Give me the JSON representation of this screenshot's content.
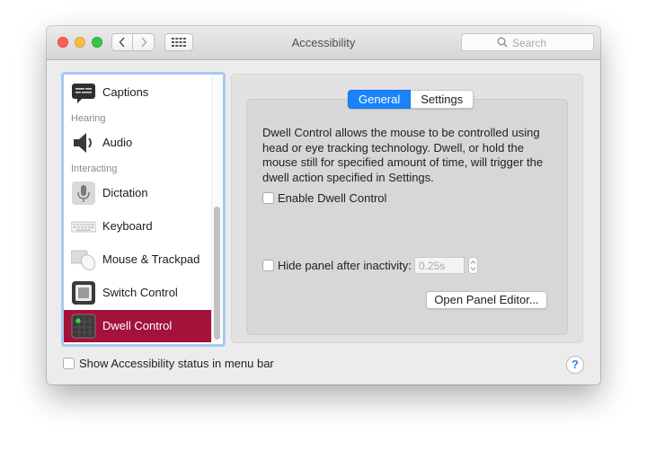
{
  "window": {
    "title": "Accessibility"
  },
  "search": {
    "placeholder": "Search"
  },
  "sidebar": {
    "items": [
      {
        "label": "Captions",
        "icon": "captions-icon"
      },
      {
        "section": "Hearing"
      },
      {
        "label": "Audio",
        "icon": "speaker-icon"
      },
      {
        "section": "Interacting"
      },
      {
        "label": "Dictation",
        "icon": "microphone-icon"
      },
      {
        "label": "Keyboard",
        "icon": "keyboard-icon"
      },
      {
        "label": "Mouse & Trackpad",
        "icon": "mouse-trackpad-icon"
      },
      {
        "label": "Switch Control",
        "icon": "switch-control-icon"
      },
      {
        "label": "Dwell Control",
        "icon": "dwell-control-icon",
        "selected": true
      }
    ]
  },
  "tabs": [
    {
      "label": "General",
      "active": true
    },
    {
      "label": "Settings",
      "active": false
    }
  ],
  "general": {
    "description": "Dwell Control allows the mouse to be controlled using head or eye tracking technology. Dwell, or hold the mouse still for specified amount of time, will trigger the dwell action specified in Settings.",
    "enable_label": "Enable Dwell Control",
    "enable_checked": false,
    "hide_panel_label": "Hide panel after inactivity:",
    "hide_panel_checked": false,
    "hide_panel_value": "0.25s",
    "open_panel_button": "Open Panel Editor..."
  },
  "footer": {
    "status_label": "Show Accessibility status in menu bar",
    "status_checked": false,
    "help_label": "?"
  },
  "colors": {
    "selection": "#a3123a",
    "tab_active": "#1a82fb",
    "close": "#fc605b",
    "minimize": "#fdbc40",
    "zoom": "#34c84a"
  }
}
